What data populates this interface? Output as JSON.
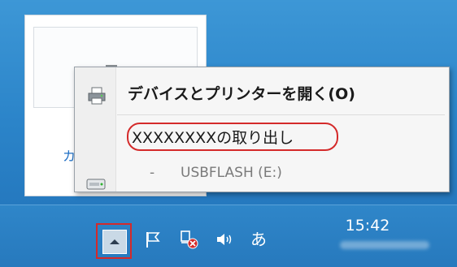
{
  "background_window": {
    "partial_link_text": "カ"
  },
  "context_menu": {
    "items": [
      {
        "label": "デバイスとプリンターを開く(O)",
        "icon": "printer-icon"
      },
      {
        "label": "XXXXXXXXの取り出し",
        "icon": "usb-drive-icon"
      },
      {
        "dash": "-",
        "label": "USBFLASH (E:)"
      }
    ]
  },
  "taskbar": {
    "tray_icons": [
      "show-hidden-icons-icon",
      "action-center-flag-icon",
      "network-error-icon",
      "volume-icon",
      "ime-icon"
    ],
    "ime_text": "あ",
    "clock_time": "15:42"
  },
  "colors": {
    "highlight": "#d42a2a",
    "taskbar": "#2779bd"
  }
}
